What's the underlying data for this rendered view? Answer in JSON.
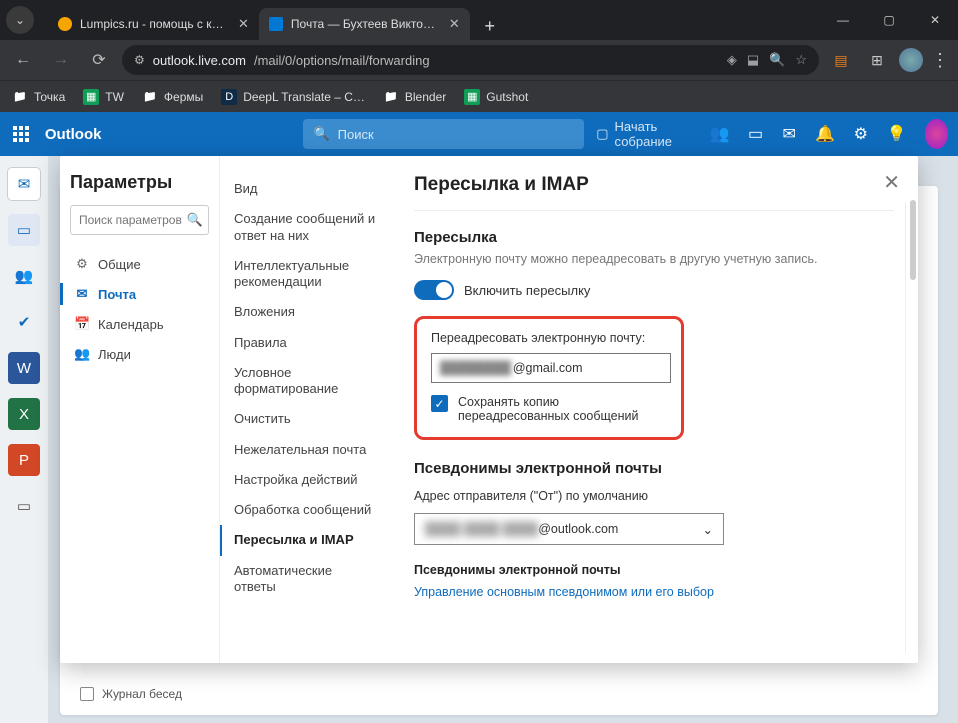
{
  "browser": {
    "tabs": [
      {
        "title": "Lumpics.ru - помощь с компью",
        "favicon_color": "#f7a600"
      },
      {
        "title": "Почта — Бухтеев Виктор — Ou",
        "favicon_color": "#0078d4"
      }
    ],
    "url_prefix": "outlook.live.com",
    "url_path": "/mail/0/options/mail/forwarding",
    "bookmarks": [
      "Точка",
      "TW",
      "Фермы",
      "DeepL Translate – C…",
      "Blender",
      "Gutshot"
    ]
  },
  "outlook": {
    "brand": "Outlook",
    "search_placeholder": "Поиск",
    "meet_label": "Начать собрание"
  },
  "backdrop": {
    "journal": "Журнал бесед"
  },
  "settings": {
    "title": "Параметры",
    "search_placeholder": "Поиск параметров",
    "categories": [
      {
        "icon": "⚙",
        "label": "Общие"
      },
      {
        "icon": "✉",
        "label": "Почта",
        "active": true
      },
      {
        "icon": "📅",
        "label": "Календарь"
      },
      {
        "icon": "👥",
        "label": "Люди"
      }
    ],
    "subsections": [
      "Вид",
      "Создание сообщений и ответ на них",
      "Интеллектуальные рекомендации",
      "Вложения",
      "Правила",
      "Условное форматирование",
      "Очистить",
      "Нежелательная почта",
      "Настройка действий",
      "Обработка сообщений",
      "Пересылка и IMAP",
      "Автоматические ответы"
    ],
    "subsection_active_index": 10
  },
  "panel": {
    "title": "Пересылка и IMAP",
    "forwarding_h": "Пересылка",
    "forwarding_desc": "Электронную почту можно переадресовать в другую учетную запись.",
    "toggle_label": "Включить пересылку",
    "forward_to_label": "Переадресовать электронную почту:",
    "forward_email_blur": "████████",
    "forward_email_suffix": "@gmail.com",
    "keep_copy_label": "Сохранять копию переадресованных сообщений",
    "aliases_h": "Псевдонимы электронной почты",
    "default_from_label": "Адрес отправителя (\"От\") по умолчанию",
    "select_blur": "████ ████ ████",
    "select_suffix": "@outlook.com",
    "aliases_sub": "Псевдонимы электронной почты",
    "manage_link": "Управление основным псевдонимом или его выбор"
  }
}
